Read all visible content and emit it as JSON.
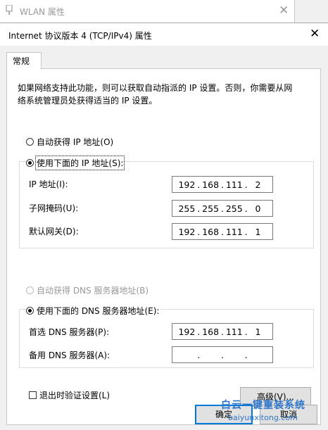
{
  "background_window": {
    "title": "WLAN 属性",
    "close": "✕"
  },
  "dialog": {
    "title": "Internet 协议版本 4 (TCP/IPv4) 属性",
    "close": "✕",
    "tab": "常规",
    "intro_line1": "如果网络支持此功能，则可以获取自动指派的 IP 设置。否则，你需要从网",
    "intro_line2": "络系统管理员处获得适当的 IP 设置。",
    "ip_mode": {
      "auto_label": "自动获得 IP 地址(O)",
      "manual_label": "使用下面的 IP 地址(S):",
      "selected": "manual"
    },
    "ip_fields": {
      "ip_label": "IP 地址(I):",
      "ip_value": [
        "192",
        "168",
        "111",
        "2"
      ],
      "mask_label": "子网掩码(U):",
      "mask_value": [
        "255",
        "255",
        "255",
        "0"
      ],
      "gateway_label": "默认网关(D):",
      "gateway_value": [
        "192",
        "168",
        "111",
        "1"
      ]
    },
    "dns_mode": {
      "auto_label": "自动获得 DNS 服务器地址(B)",
      "manual_label": "使用下面的 DNS 服务器地址(E):",
      "selected": "manual"
    },
    "dns_fields": {
      "preferred_label": "首选 DNS 服务器(P):",
      "preferred_value": [
        "192",
        "168",
        "111",
        "1"
      ],
      "alternate_label": "备用 DNS 服务器(A):",
      "alternate_value": [
        "",
        "",
        "",
        ""
      ]
    },
    "validate_label": "退出时验证设置(L)",
    "validate_checked": false,
    "advanced_button": "高级(V)...",
    "ok_button": "确定",
    "cancel_button": "取消"
  },
  "watermark": {
    "text_cn": "白云一键重装系统",
    "text_en": "baiyunxitong.com"
  },
  "colors": {
    "accent": "#0078d7",
    "watermark": "#2f75c9"
  }
}
